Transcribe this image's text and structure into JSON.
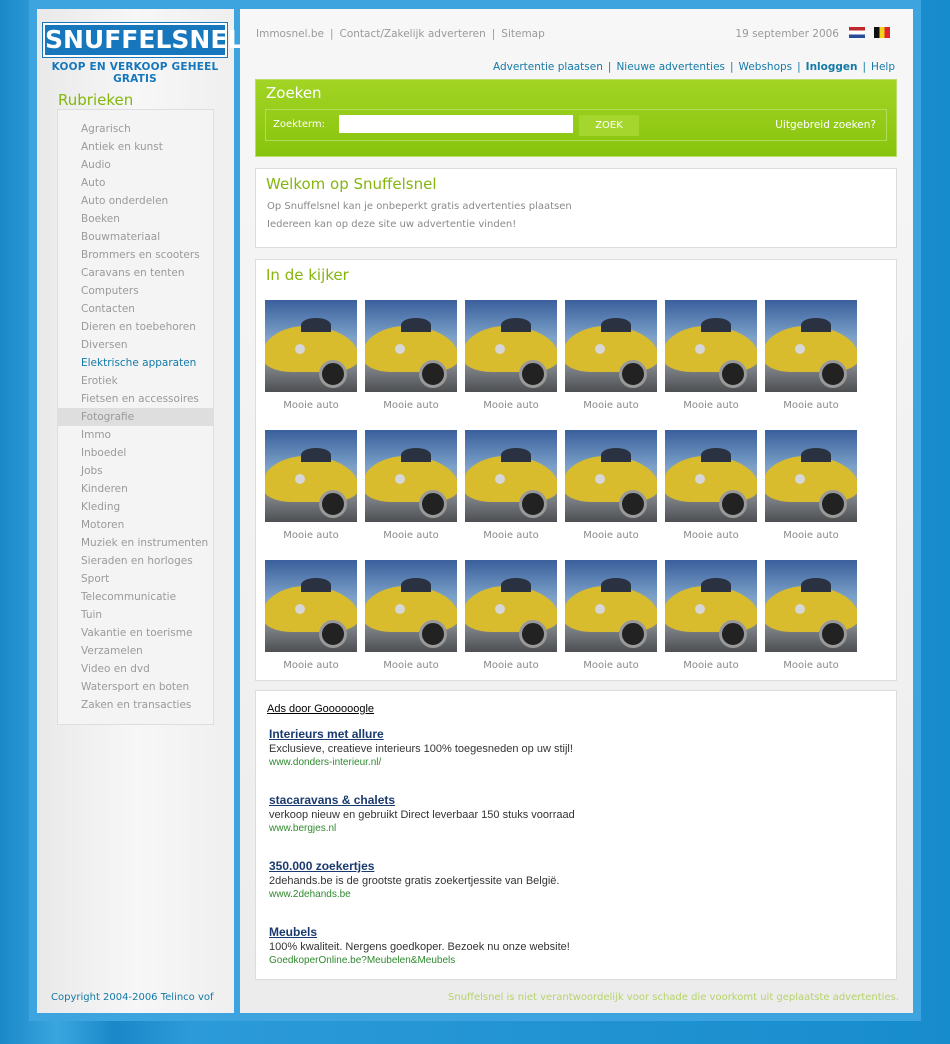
{
  "logo": {
    "top": "SNUFFELSNEL",
    "tagline": "KOOP EN VERKOOP GEHEEL GRATIS"
  },
  "sidebar": {
    "title": "Rubrieken",
    "categories": [
      "Agrarisch",
      "Antiek en kunst",
      "Audio",
      "Auto",
      "Auto onderdelen",
      "Boeken",
      "Bouwmateriaal",
      "Brommers en scooters",
      "Caravans en tenten",
      "Computers",
      "Contacten",
      "Dieren en toebehoren",
      "Diversen",
      "Elektrische apparaten",
      "Erotiek",
      "Fietsen en accessoires",
      "Fotografie",
      "Immo",
      "Inboedel",
      "Jobs",
      "Kinderen",
      "Kleding",
      "Motoren",
      "Muziek en instrumenten",
      "Sieraden en horloges",
      "Sport",
      "Telecommunicatie",
      "Tuin",
      "Vakantie en toerisme",
      "Verzamelen",
      "Video en dvd",
      "Watersport en boten",
      "Zaken en transacties"
    ],
    "highlighted": "Elektrische apparaten",
    "selected": "Fotografie",
    "copyright": "Copyright 2004-2006 Telinco vof"
  },
  "topnav": {
    "links": [
      "Immosnel.be",
      "Contact/Zakelijk adverteren",
      "Sitemap"
    ],
    "date": "19 september 2006"
  },
  "mainnav": {
    "links": [
      "Advertentie plaatsen",
      "Nieuwe advertenties",
      "Webshops",
      "Inloggen",
      "Help"
    ]
  },
  "search": {
    "title": "Zoeken",
    "label": "Zoekterm:",
    "value": "",
    "button": "ZOEK",
    "advanced": "Uitgebreid zoeken?"
  },
  "welcome": {
    "title": "Welkom op Snuffelsnel",
    "lines": [
      "Op Snuffelsnel kan je onbeperkt gratis advertenties plaatsen",
      "Iedereen kan op deze site uw advertentie vinden!"
    ]
  },
  "kijker": {
    "title": "In de kijker",
    "items": [
      "Mooie auto",
      "Mooie auto",
      "Mooie auto",
      "Mooie auto",
      "Mooie auto",
      "Mooie auto",
      "Mooie auto",
      "Mooie auto",
      "Mooie auto",
      "Mooie auto",
      "Mooie auto",
      "Mooie auto",
      "Mooie auto",
      "Mooie auto",
      "Mooie auto",
      "Mooie auto",
      "Mooie auto",
      "Mooie auto"
    ]
  },
  "ads": {
    "header": "Ads door Goooooogle",
    "items": [
      {
        "title": "Interieurs met allure",
        "desc": "Exclusieve, creatieve interieurs 100% toegesneden op uw stijl!",
        "url": "www.donders-interieur.nl/"
      },
      {
        "title": "stacaravans & chalets",
        "desc": "verkoop nieuw en gebruikt Direct leverbaar 150 stuks voorraad",
        "url": "www.bergjes.nl"
      },
      {
        "title": "350.000 zoekertjes",
        "desc": "2dehands.be is de grootste gratis zoekertjessite van België.",
        "url": "www.2dehands.be"
      },
      {
        "title": "Meubels",
        "desc": "100% kwaliteit. Nergens goedkoper. Bezoek nu onze website!",
        "url": "GoedkoperOnline.be?Meubelen&Meubels"
      }
    ]
  },
  "disclaimer": "Snuffelsnel is niet verantwoordelijk voor schade die voorkomt uit geplaatste advertenties.",
  "colors": {
    "accent_green": "#85b60e",
    "link_blue": "#1479a6",
    "page_blue": "#1a88c8"
  }
}
